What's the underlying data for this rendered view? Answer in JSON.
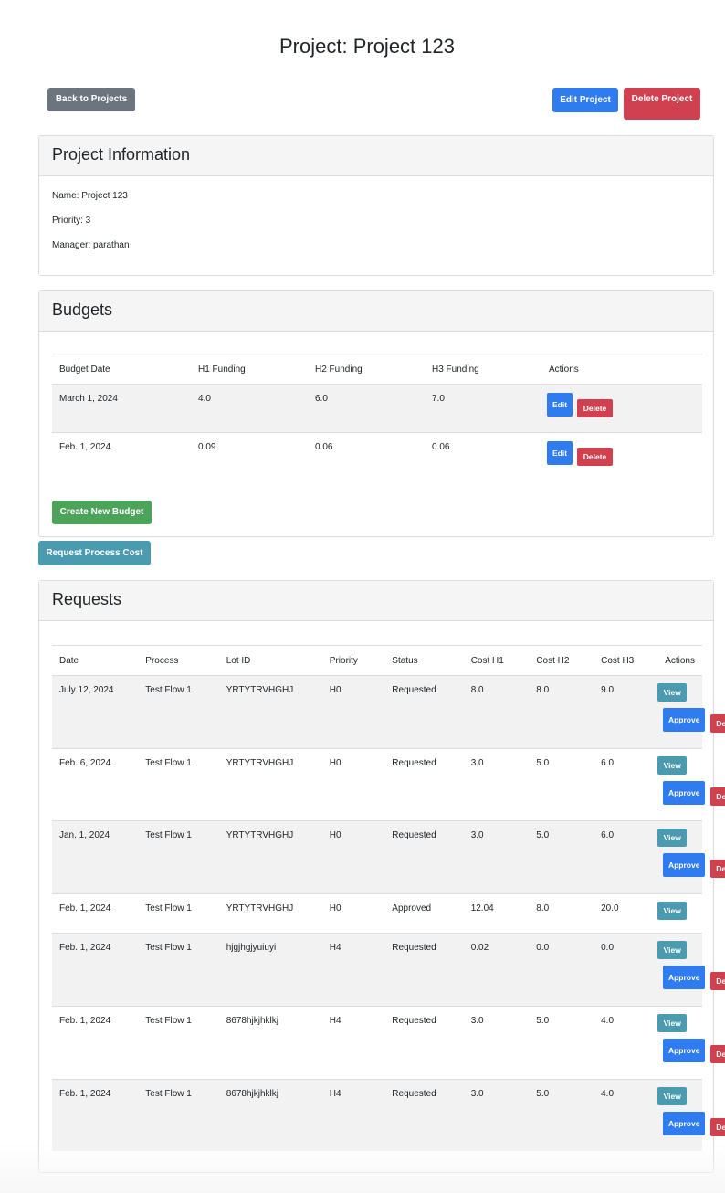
{
  "page": {
    "title": "Project: Project 123"
  },
  "toolbar": {
    "back_label": "Back to Projects",
    "edit_label": "Edit Project",
    "delete_label": "Delete Project"
  },
  "info": {
    "header": "Project Information",
    "name": "Name: Project 123",
    "priority": "Priority: 3",
    "manager": "Manager: parathan"
  },
  "budgets": {
    "header": "Budgets",
    "columns": [
      "Budget Date",
      "H1 Funding",
      "H2 Funding",
      "H3 Funding",
      "Actions"
    ],
    "rows": [
      {
        "date": "March 1, 2024",
        "h1": "4.0",
        "h2": "6.0",
        "h3": "7.0"
      },
      {
        "date": "Feb. 1, 2024",
        "h1": "0.09",
        "h2": "0.06",
        "h3": "0.06"
      }
    ],
    "edit_label": "Edit",
    "delete_label": "Delete",
    "create_label": "Create New Budget"
  },
  "request_cost_label": "Request Process Cost",
  "requests": {
    "header": "Requests",
    "columns": [
      "Date",
      "Process",
      "Lot ID",
      "Priority",
      "Status",
      "Cost H1",
      "Cost H2",
      "Cost H3",
      "Actions"
    ],
    "rows": [
      {
        "date": "July 12, 2024",
        "process": "Test Flow 1",
        "lot": "YRTYTRVHGHJ",
        "priority": "H0",
        "status": "Requested",
        "c1": "8.0",
        "c2": "8.0",
        "c3": "9.0"
      },
      {
        "date": "Feb. 6, 2024",
        "process": "Test Flow 1",
        "lot": "YRTYTRVHGHJ",
        "priority": "H0",
        "status": "Requested",
        "c1": "3.0",
        "c2": "5.0",
        "c3": "6.0"
      },
      {
        "date": "Jan. 1, 2024",
        "process": "Test Flow 1",
        "lot": "YRTYTRVHGHJ",
        "priority": "H0",
        "status": "Requested",
        "c1": "3.0",
        "c2": "5.0",
        "c3": "6.0"
      },
      {
        "date": "Feb. 1, 2024",
        "process": "Test Flow 1",
        "lot": "YRTYTRVHGHJ",
        "priority": "H0",
        "status": "Approved",
        "c1": "12.04",
        "c2": "8.0",
        "c3": "20.0"
      },
      {
        "date": "Feb. 1, 2024",
        "process": "Test Flow 1",
        "lot": "hjgjhgjyuiuyi",
        "priority": "H4",
        "status": "Requested",
        "c1": "0.02",
        "c2": "0.0",
        "c3": "0.0"
      },
      {
        "date": "Feb. 1, 2024",
        "process": "Test Flow 1",
        "lot": "8678hjkjhklkj",
        "priority": "H4",
        "status": "Requested",
        "c1": "3.0",
        "c2": "5.0",
        "c3": "4.0"
      },
      {
        "date": "Feb. 1, 2024",
        "process": "Test Flow 1",
        "lot": "8678hjkjhklkj",
        "priority": "H4",
        "status": "Requested",
        "c1": "3.0",
        "c2": "5.0",
        "c3": "4.0"
      }
    ],
    "view_label": "View",
    "approve_label": "Approve",
    "deny_label": "Deny"
  },
  "colors": {
    "primary": "#2f7bf0",
    "danger": "#d0404e",
    "success": "#4ca35a",
    "info": "#4a9bb0",
    "secondary": "#6c757d"
  }
}
